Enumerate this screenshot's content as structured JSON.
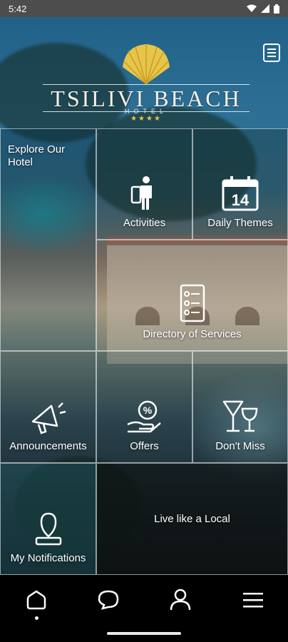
{
  "status_bar": {
    "time": "5:42"
  },
  "header": {
    "logo": {
      "title": "TSILIVI BEACH",
      "subtitle": "HOTEL",
      "stars": "★★★★"
    }
  },
  "tiles": {
    "explore": "Explore Our Hotel",
    "activities": "Activities",
    "daily_themes": "Daily Themes",
    "daily_themes_day": "14",
    "directory": "Directory of Services",
    "announcements": "Announcements",
    "offers": "Offers",
    "dont_miss": "Don't Miss",
    "notifications": "My Notifications",
    "live_local": "Live like a Local"
  },
  "bottom_nav": {
    "items": [
      "home-icon",
      "chat-icon",
      "profile-icon",
      "hamburger-menu-icon"
    ],
    "active": "home-icon"
  },
  "colors": {
    "accent_gold": "#e7c54a",
    "nav_bg": "#000000",
    "status_bar_bg": "#4d4d4d"
  }
}
